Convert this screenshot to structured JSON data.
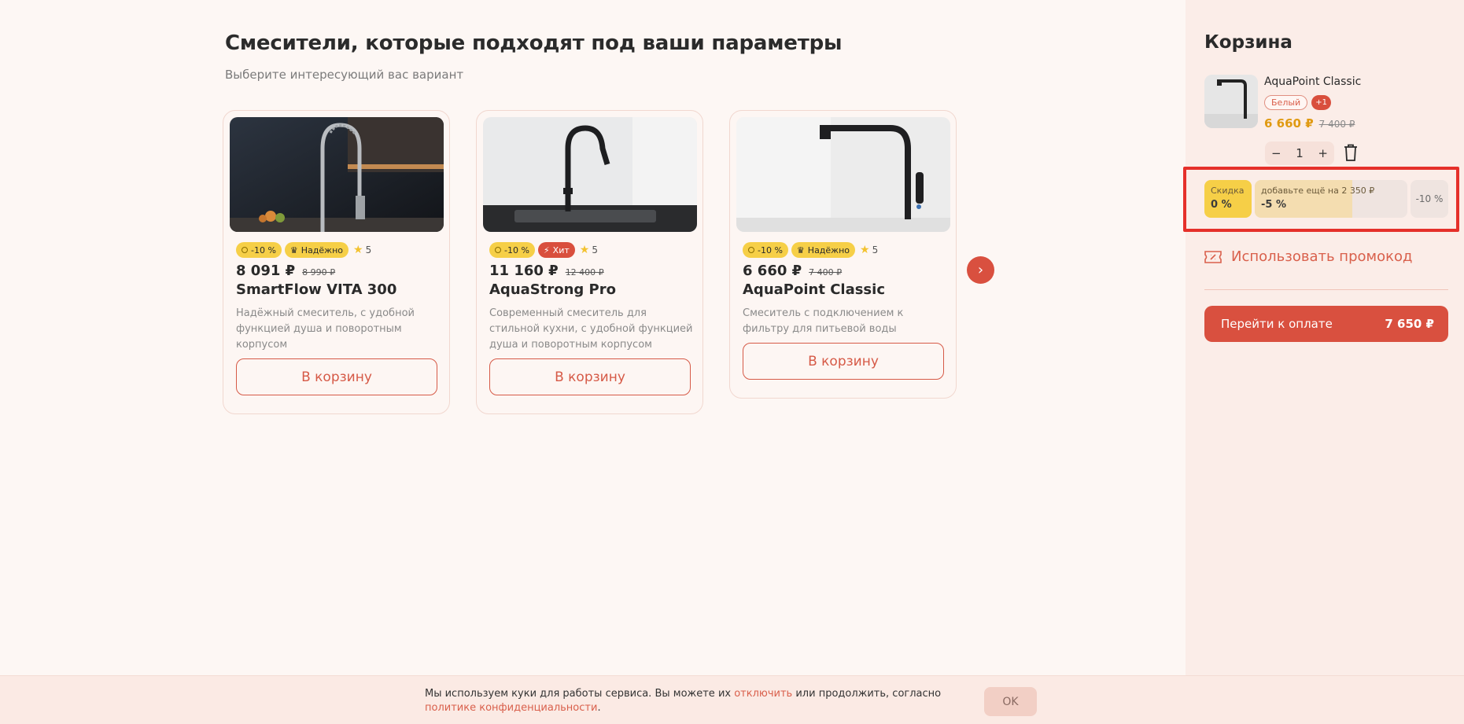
{
  "page": {
    "title": "Смесители, которые подходят под ваши параметры",
    "subtitle": "Выберите интересующий вас вариант"
  },
  "products": [
    {
      "discount_badge": "-10 %",
      "second_badge": "Надёжно",
      "second_badge_icon": "crown-icon",
      "rating": "5",
      "price": "8 091 ₽",
      "old_price": "8 990 ₽",
      "title": "SmartFlow VITA 300",
      "description": "Надёжный смеситель, с удобной функцией душа и поворотным корпусом",
      "button": "В корзину"
    },
    {
      "discount_badge": "-10 %",
      "second_badge": "Хит",
      "second_badge_icon": "lightning-icon",
      "rating": "5",
      "price": "11 160 ₽",
      "old_price": "12 400 ₽",
      "title": "AquaStrong Pro",
      "description": "Современный смеситель для стильной кухни, с удобной функцией душа и поворотным корпусом",
      "button": "В корзину"
    },
    {
      "discount_badge": "-10 %",
      "second_badge": "Надёжно",
      "second_badge_icon": "crown-icon",
      "rating": "5",
      "price": "6 660 ₽",
      "old_price": "7 400 ₽",
      "title": "AquaPoint Classic",
      "description": "Смеситель с подключением к фильтру для питьевой воды",
      "button": "В корзину"
    }
  ],
  "cart": {
    "title": "Корзина",
    "item": {
      "name": "AquaPoint Classic",
      "color": "Белый",
      "more_colors": "+1",
      "price": "6 660 ₽",
      "old_price": "7 400 ₽",
      "qty_minus": "−",
      "quantity": "1",
      "qty_plus": "+"
    },
    "discount": {
      "current_label": "Скидка",
      "current_value": "0 %",
      "next_label": "добавьте ещё на 2 350 ₽",
      "next_value": "-5 %",
      "next_progress_percent": 64,
      "max_value": "-10 %"
    },
    "promo_label": "Использовать промокод",
    "checkout_label": "Перейти к оплате",
    "checkout_total": "7 650 ₽"
  },
  "cookie": {
    "text_before": "Мы используем куки для работы сервиса. Вы можете их ",
    "link_disable": "отключить",
    "text_middle": " или продолжить, согласно ",
    "link_policy": "политике конфиденциальности",
    "text_end": ".",
    "ok": "OK"
  },
  "colors": {
    "accent": "#d9503f",
    "badge_yellow": "#f6cf47",
    "price_orange": "#e09a12",
    "background": "#fdf7f4",
    "sidebar_bg": "#fbede8",
    "highlight_border": "#e5302a"
  }
}
